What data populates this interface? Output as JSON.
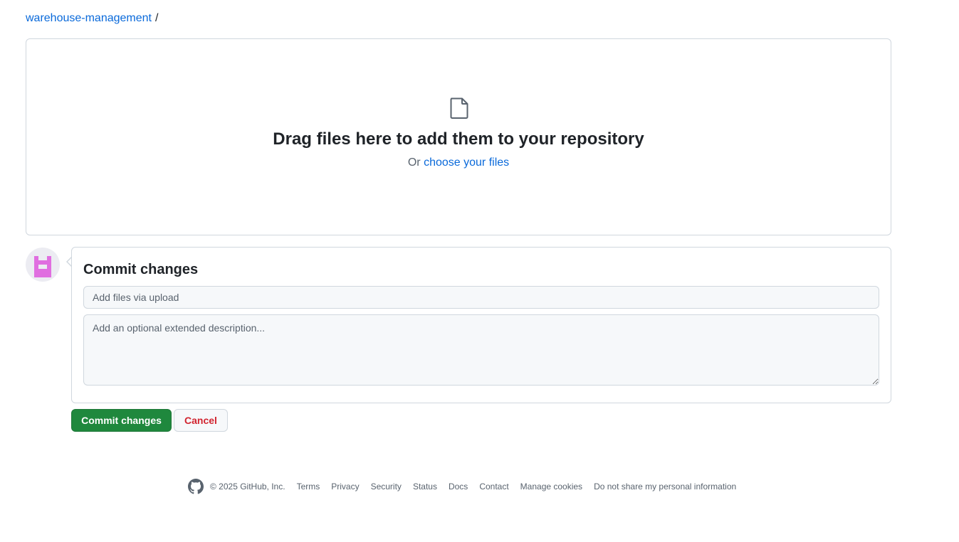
{
  "breadcrumb": {
    "repo": "warehouse-management",
    "separator": "/"
  },
  "dropzone": {
    "icon": "file-icon",
    "title": "Drag files here to add them to your repository",
    "prefix": "Or",
    "choose_link": "choose your files"
  },
  "commit": {
    "avatar_color": "#e06ee0",
    "title": "Commit changes",
    "summary_placeholder": "Add files via upload",
    "description_placeholder": "Add an optional extended description...",
    "commit_button": "Commit changes",
    "cancel_button": "Cancel",
    "commit_color": "#1f883d",
    "cancel_color": "#d1242f"
  },
  "footer": {
    "logo": "github-logo-icon",
    "copyright": "© 2025 GitHub, Inc.",
    "links": [
      "Terms",
      "Privacy",
      "Security",
      "Status",
      "Docs",
      "Contact",
      "Manage cookies",
      "Do not share my personal information"
    ]
  },
  "colors": {
    "link": "#0969da",
    "border": "#d0d7de"
  }
}
